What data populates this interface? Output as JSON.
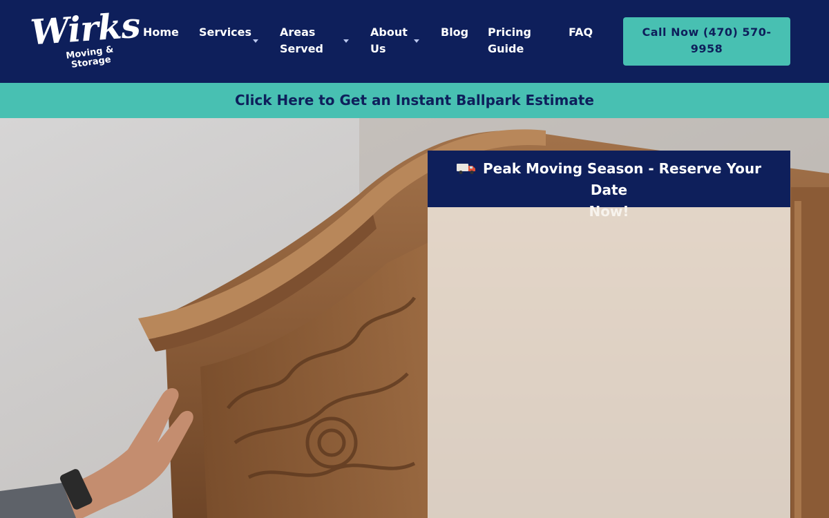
{
  "brand": {
    "name": "Wirks",
    "tagline_line1": "Moving &",
    "tagline_line2": "Storage"
  },
  "nav": {
    "items": [
      {
        "label_line1": "Home",
        "label_line2": "",
        "has_dropdown": false
      },
      {
        "label_line1": "Services",
        "label_line2": "",
        "has_dropdown": true
      },
      {
        "label_line1": "Areas",
        "label_line2": "Served",
        "has_dropdown": true
      },
      {
        "label_line1": "About",
        "label_line2": "Us",
        "has_dropdown": true
      },
      {
        "label_line1": "Blog",
        "label_line2": "",
        "has_dropdown": false
      },
      {
        "label_line1": "Pricing",
        "label_line2": "Guide",
        "has_dropdown": false
      },
      {
        "label_line1": "FAQ",
        "label_line2": "",
        "has_dropdown": false
      }
    ],
    "cta_line1": "Call Now (470) 570-",
    "cta_line2": "9958"
  },
  "banner": {
    "text": "Click Here to Get an Instant Ballpark Estimate"
  },
  "promo": {
    "icon": "truck-icon",
    "line1": "Peak Moving Season - Reserve Your Date",
    "line2": "Now!"
  },
  "colors": {
    "navy": "#0e1f5b",
    "teal": "#48c0b2",
    "white": "#ffffff",
    "caret": "#b9c6ee"
  }
}
